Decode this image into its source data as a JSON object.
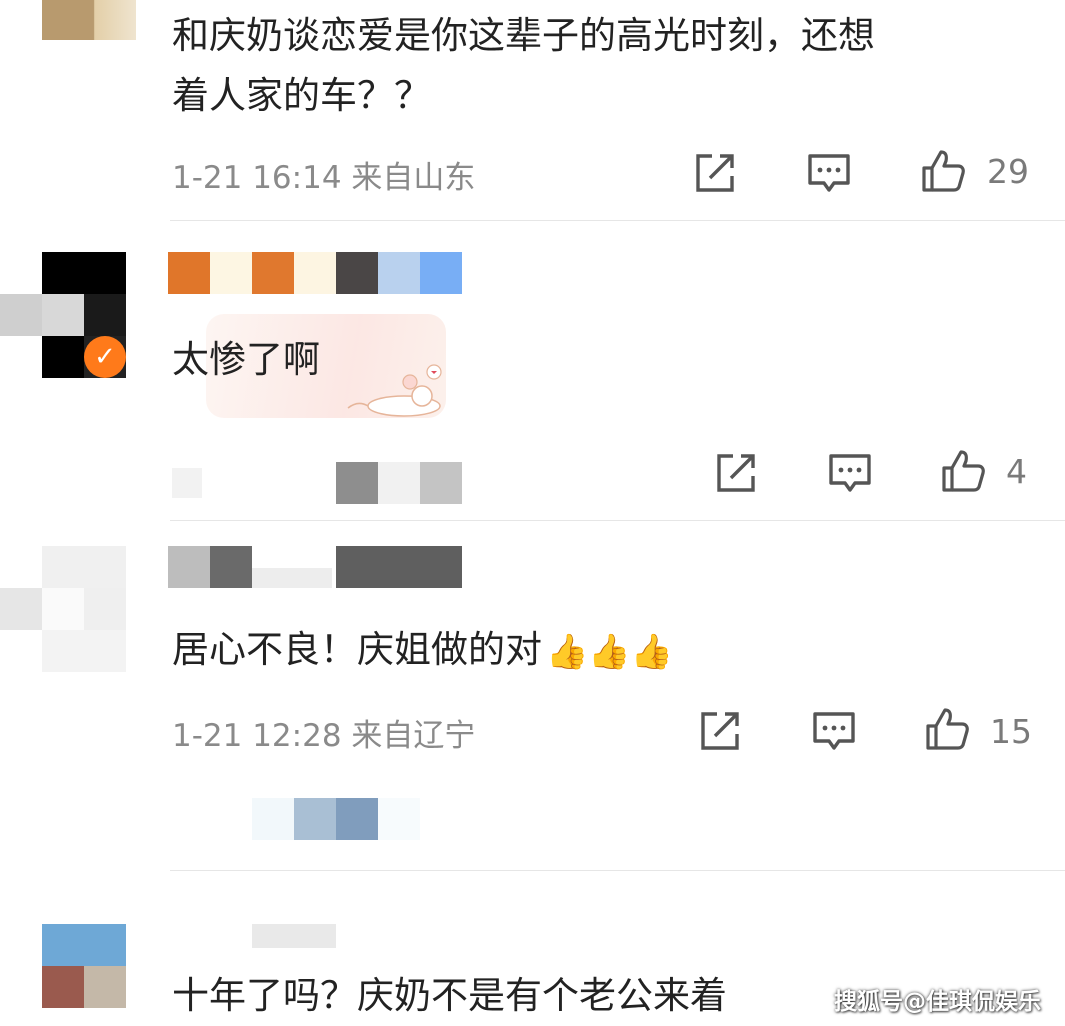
{
  "colors": {
    "text": "#222222",
    "meta": "#8a8a8a",
    "divider": "#e6e6e6",
    "verified_badge": "#ff7a1a"
  },
  "comments": [
    {
      "text_line1": "和庆奶谈恋爱是你这辈子的高光时刻，还想",
      "text_line2": "着人家的车？？",
      "meta": "1-21 16:14  来自山东",
      "likes": "29"
    },
    {
      "text": "太惨了啊",
      "likes": "4"
    },
    {
      "text": "居心不良！庆姐做的对",
      "emojis": "👍👍👍",
      "meta": "1-21 12:28  来自辽宁",
      "likes": "15"
    },
    {
      "text": "十年了吗？庆奶不是有个老公来着"
    }
  ],
  "icons": {
    "share": "share-icon",
    "comment": "comment-icon",
    "like": "thumbs-up-icon",
    "verified": "verified-badge-icon"
  },
  "watermark": "搜狐号@佳琪侃娱乐"
}
